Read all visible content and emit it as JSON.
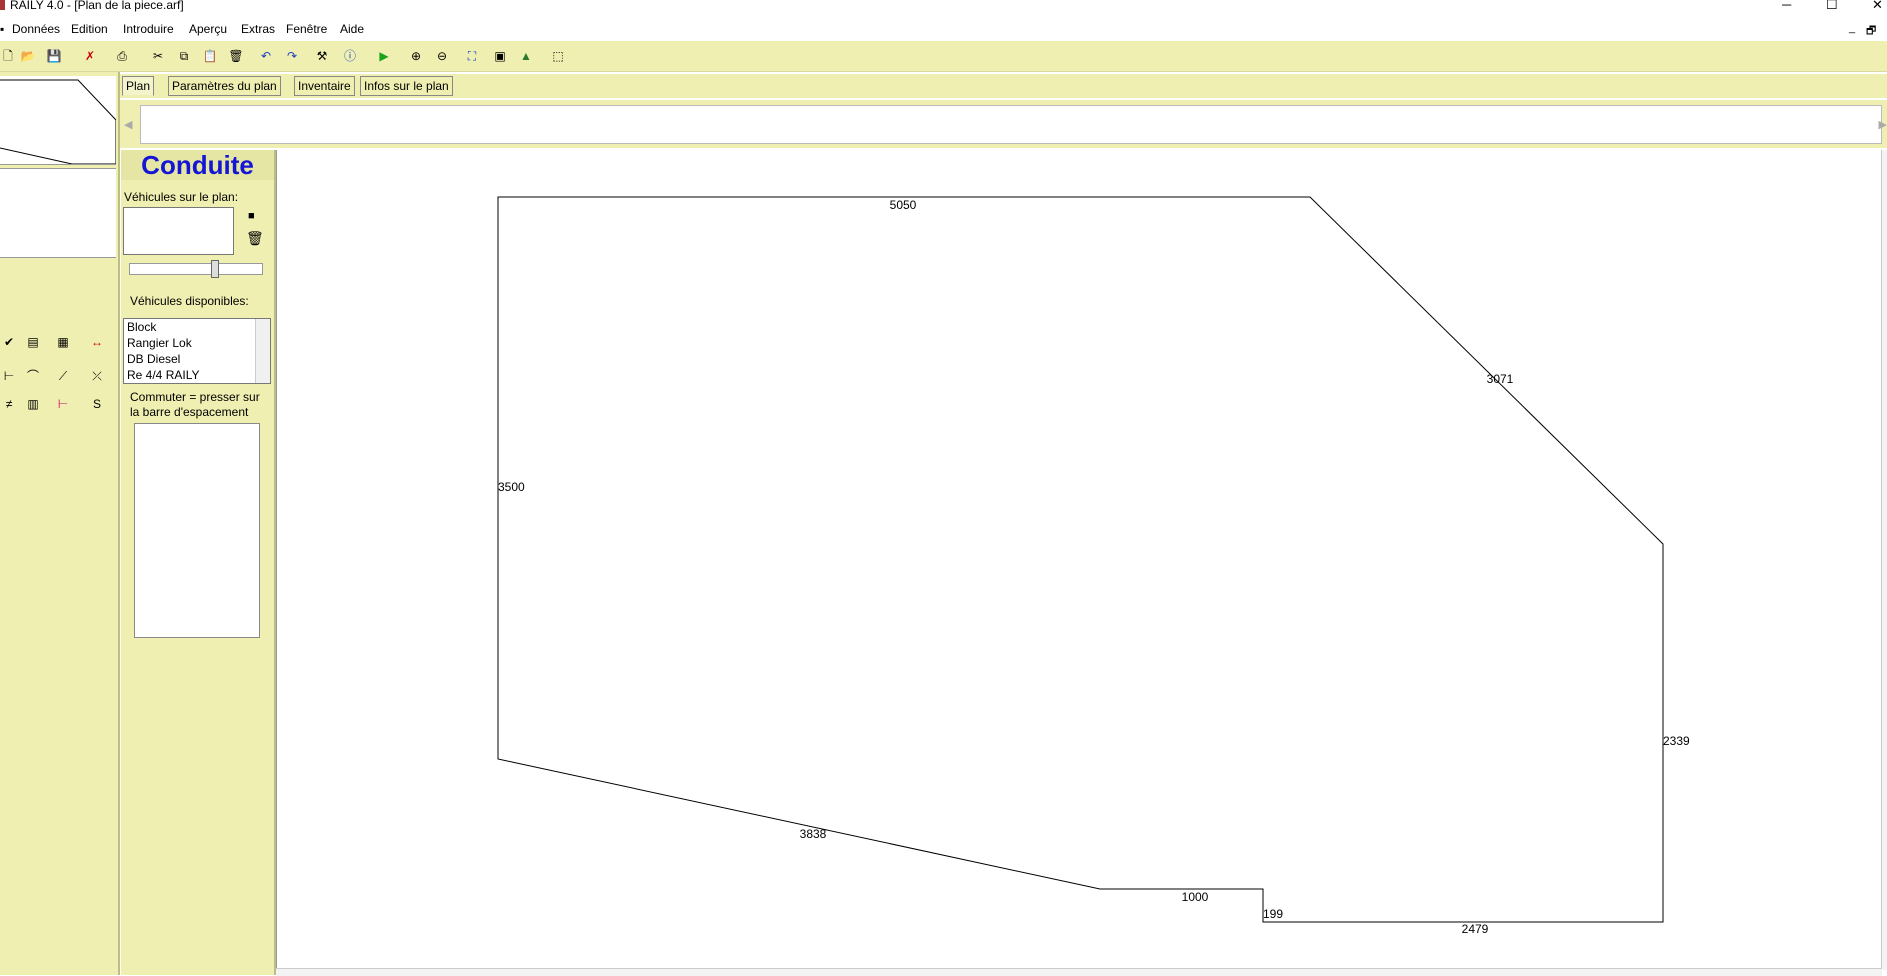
{
  "window": {
    "title": "RAILY 4.0 - [Plan de la piece.arf]",
    "minimize": "─",
    "maximize": "☐",
    "close": "✕"
  },
  "menu": {
    "items": [
      "Données",
      "Edition",
      "Introduire",
      "Aperçu",
      "Extras",
      "Fenêtre",
      "Aide"
    ],
    "mdi_min": "_",
    "mdi_restore": "🗗"
  },
  "toolbar": {
    "icons": [
      "new-icon",
      "open-icon",
      "save-icon",
      "delete-x-icon",
      "print-icon",
      "cut-icon",
      "copy-icon",
      "paste-icon",
      "trash-icon",
      "undo-icon",
      "redo-icon",
      "properties-icon",
      "info-icon",
      "run-icon",
      "zoom-in-icon",
      "zoom-out-icon",
      "zoom-fit-icon",
      "view-3d-icon",
      "mountain-icon",
      "box-icon"
    ]
  },
  "tabs": [
    {
      "label": "Plan",
      "active": true
    },
    {
      "label": "Paramètres du plan",
      "active": false
    },
    {
      "label": "Inventaire",
      "active": false
    },
    {
      "label": "Infos sur le plan",
      "active": false
    }
  ],
  "conduite": {
    "heading": "Conduite",
    "vehicles_on_plan_label": "Véhicules sur le plan:",
    "vehicles_available_label": "Véhicules disponibles:",
    "available": [
      "Block",
      "Rangier Lok",
      "DB Diesel",
      "Re 4/4 RAILY"
    ],
    "hint_line1": "Commuter = presser sur",
    "hint_line2": "la barre d'espacement",
    "stop_glyph": "■",
    "trash_glyph": "🗑"
  },
  "plan": {
    "accent": "#000000",
    "dimensions": [
      {
        "id": "top",
        "value": "5050"
      },
      {
        "id": "diag",
        "value": "3071"
      },
      {
        "id": "left",
        "value": "3500"
      },
      {
        "id": "right",
        "value": "2339"
      },
      {
        "id": "bottom-diag",
        "value": "3838"
      },
      {
        "id": "step-top",
        "value": "1000"
      },
      {
        "id": "step-side",
        "value": "199"
      },
      {
        "id": "bottom",
        "value": "2479"
      }
    ]
  },
  "colors": {
    "panel": "#efefb2",
    "heading_text": "#1515d6"
  }
}
